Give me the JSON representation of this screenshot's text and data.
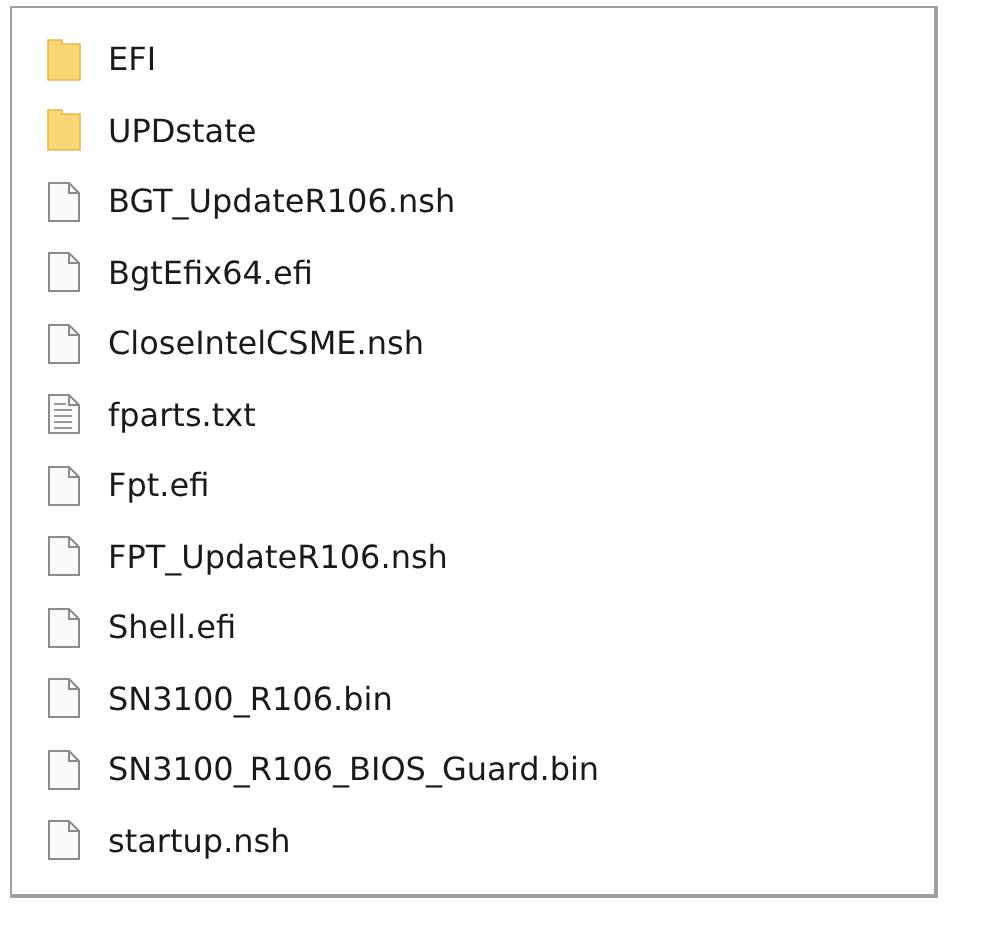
{
  "files": [
    {
      "name": "EFI",
      "kind": "folder"
    },
    {
      "name": "UPDstate",
      "kind": "folder"
    },
    {
      "name": "BGT_UpdateR106.nsh",
      "kind": "file"
    },
    {
      "name": "BgtEfix64.efi",
      "kind": "file"
    },
    {
      "name": "CloseIntelCSME.nsh",
      "kind": "file"
    },
    {
      "name": "fparts.txt",
      "kind": "text"
    },
    {
      "name": "Fpt.efi",
      "kind": "file"
    },
    {
      "name": "FPT_UpdateR106.nsh",
      "kind": "file"
    },
    {
      "name": "Shell.efi",
      "kind": "file"
    },
    {
      "name": "SN3100_R106.bin",
      "kind": "file"
    },
    {
      "name": "SN3100_R106_BIOS_Guard.bin",
      "kind": "file"
    },
    {
      "name": "startup.nsh",
      "kind": "file"
    }
  ]
}
